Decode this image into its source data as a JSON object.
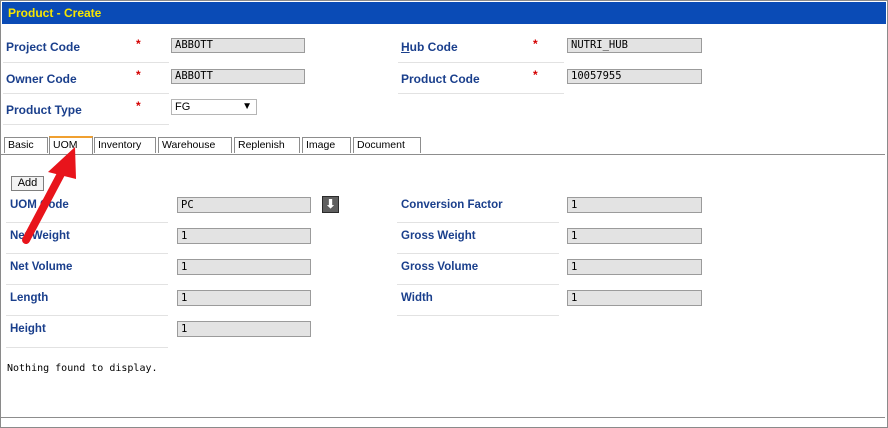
{
  "window": {
    "title": "Product -  Create"
  },
  "header_fields": {
    "project_code": {
      "label": "Project Code",
      "value": "ABBOTT"
    },
    "owner_code": {
      "label": "Owner Code",
      "value": "ABBOTT"
    },
    "product_type": {
      "label": "Product Type",
      "value": "FG"
    },
    "hub_code": {
      "label_first": "H",
      "label_rest": "ub Code",
      "value": "NUTRI_HUB"
    },
    "product_code": {
      "label": "Product Code",
      "value": "10057955"
    },
    "required_mark": "*"
  },
  "tabs": [
    {
      "label": "Basic"
    },
    {
      "label": "UOM",
      "active": true
    },
    {
      "label": "Inventory"
    },
    {
      "label": "Warehouse"
    },
    {
      "label": "Replenish"
    },
    {
      "label": "Image"
    },
    {
      "label": "Document"
    }
  ],
  "uom_panel": {
    "add_label": "Add",
    "uom_code": {
      "label": "UOM Code",
      "value": "PC"
    },
    "download_icon": "down-arrow-icon",
    "net_weight": {
      "label": "Net Weight",
      "value": "1"
    },
    "net_volume": {
      "label": "Net Volume",
      "value": "1"
    },
    "length": {
      "label": "Length",
      "value": "1"
    },
    "height": {
      "label": "Height",
      "value": "1"
    },
    "conversion_factor": {
      "label": "Conversion Factor",
      "value": "1"
    },
    "gross_weight": {
      "label": "Gross Weight",
      "value": "1"
    },
    "gross_volume": {
      "label": "Gross Volume",
      "value": "1"
    },
    "width": {
      "label": "Width",
      "value": "1"
    },
    "empty_message": "Nothing found to display."
  },
  "colors": {
    "titlebar": "#0a4bb6",
    "title_text": "#f7e600",
    "label": "#1a3f8c",
    "required": "#d40000",
    "annotation_arrow": "#e8141b"
  }
}
